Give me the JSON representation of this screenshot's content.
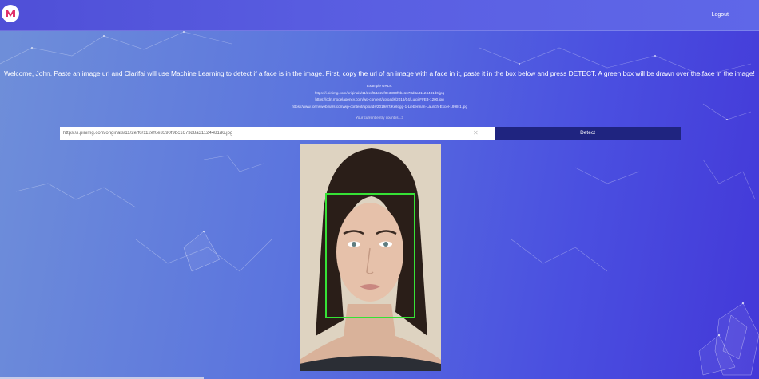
{
  "header": {
    "logout_label": "Logout",
    "logo_icon": "brain-logo-icon"
  },
  "welcome_text": "Welcome, John. Paste an image url and Clarifai will use Machine Learning to detect if a face is in the image. First, copy the url of an image with a face in it, paste it in the box below and press DETECT. A green box will be drawn over the face in the image!",
  "examples": {
    "heading": "Example URLs:",
    "urls": [
      "https://i.pinimg.com/originals/11/2e/f0/112ef0e3390f9bc1673d8a31124481d6.jpg",
      "https://cdn.modelagency.com/wp-content/uploads/2016/04/Luigi-FFE3-1200.jpg",
      "https://www.formswebinars.com/wp-content/uploads/2019/07/Kellogg-1-Lieberman-Launch-Excel-1998-1.jpg"
    ]
  },
  "entries_text": "Your current entry count is...3",
  "search": {
    "value": "https://i.pinimg.com/originals/11/2e/f0/112ef0e3390f9bc1673d8a31124481d6.jpg",
    "clear_icon": "close-icon"
  },
  "detect_label": "Detect",
  "colors": {
    "face_box": "#36e236",
    "detect_button": "#1f2480"
  }
}
